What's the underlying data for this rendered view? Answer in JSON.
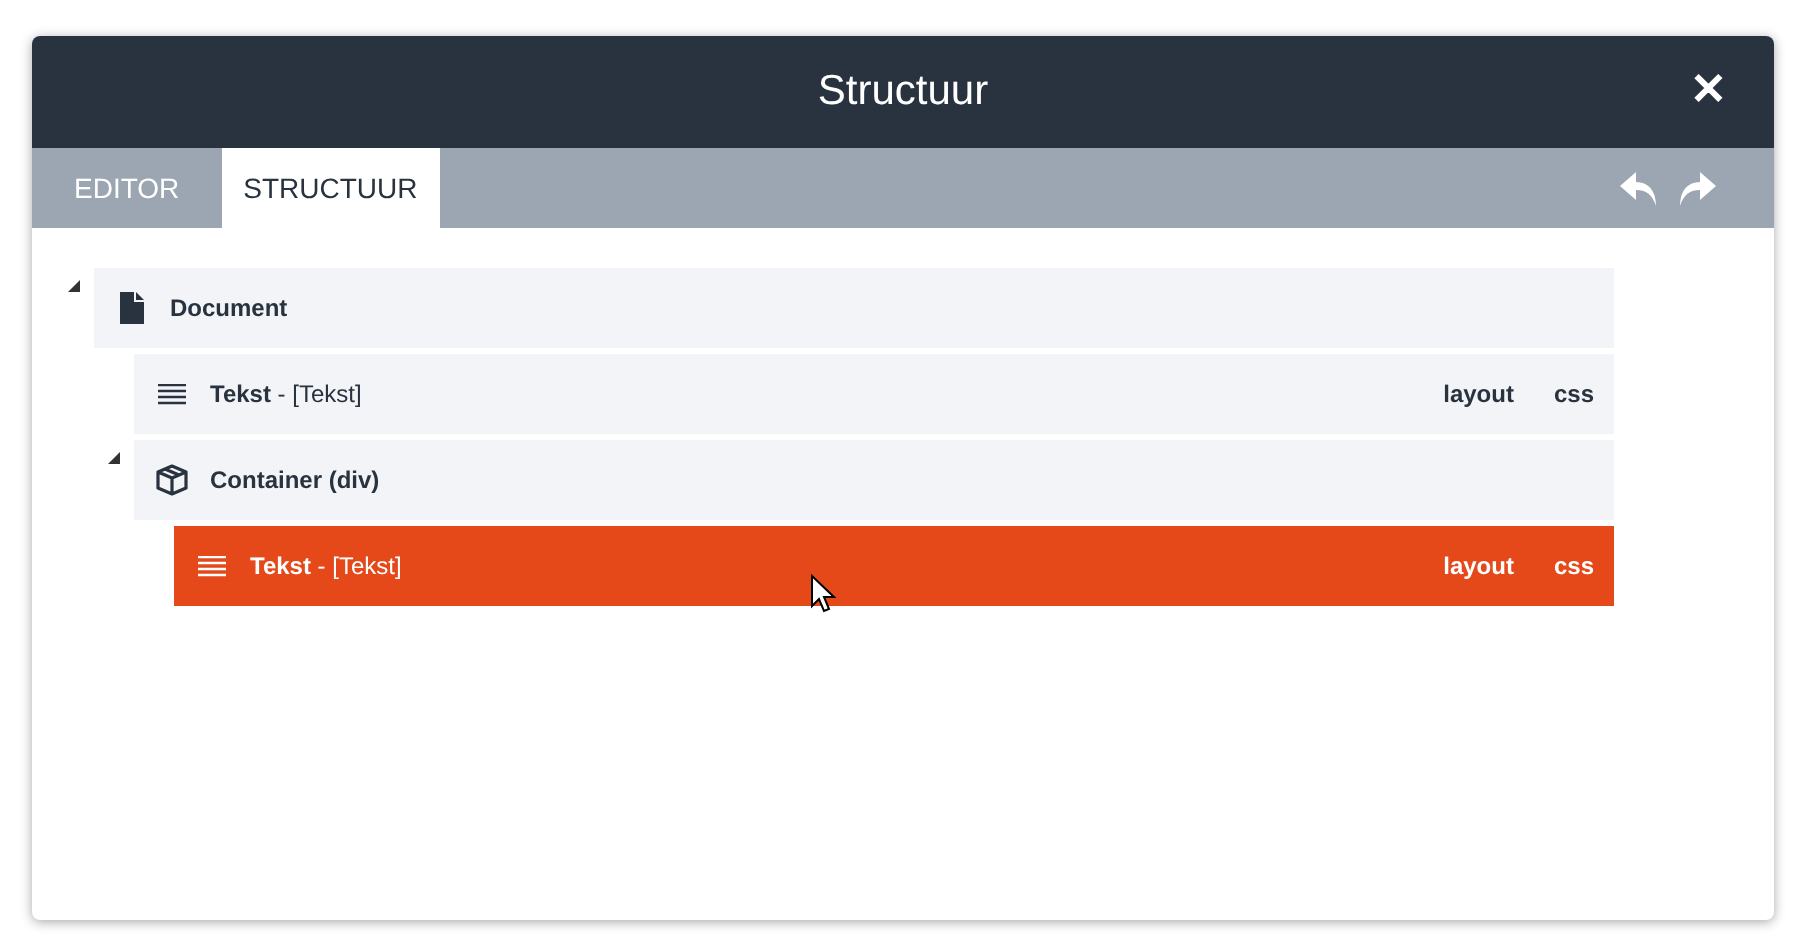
{
  "window": {
    "title": "Structuur",
    "close": "✕"
  },
  "tabs": [
    {
      "label": "EDITOR",
      "selected": false
    },
    {
      "label": "STRUCTUUR",
      "selected": true
    }
  ],
  "tree": [
    {
      "kind": "document",
      "label": "Document",
      "expanded": true,
      "selected": false,
      "children": [
        {
          "kind": "text",
          "label": "**Tekst** - [Tekst]",
          "selected": false,
          "actions": [
            "layout",
            "css"
          ]
        },
        {
          "kind": "container",
          "label": "Container (div)",
          "expanded": true,
          "selected": false,
          "children": [
            {
              "kind": "text",
              "label": "**Tekst** - [Tekst]",
              "selected": true,
              "actions": [
                "layout",
                "css"
              ]
            }
          ]
        }
      ]
    }
  ]
}
